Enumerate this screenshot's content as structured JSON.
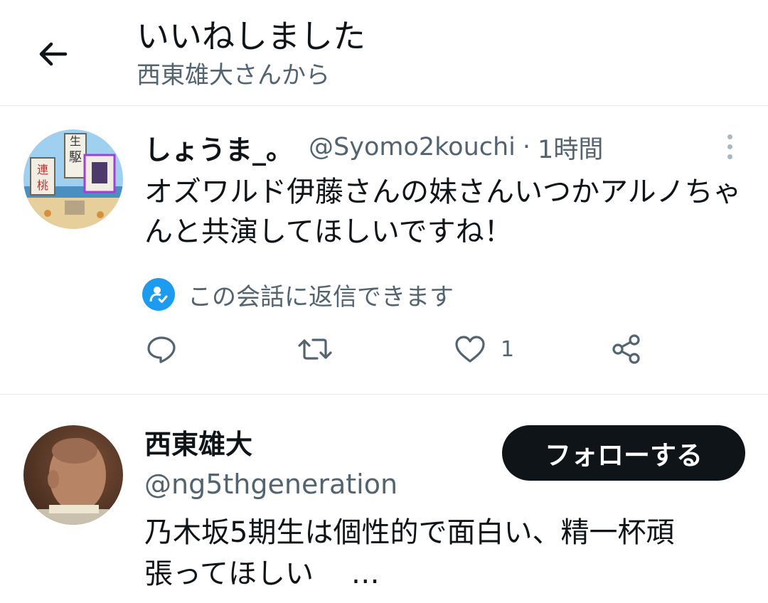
{
  "header": {
    "title": "いいねしました",
    "subtitle": "西東雄大さんから"
  },
  "tweet": {
    "name": "しょうま_。",
    "handle": "@Syomo2kouchi",
    "separator": "·",
    "time": "1時間",
    "text": "オズワルド伊藤さんの妹さんいつかアルノちゃんと共演してほしいですね！",
    "reply_note": "この会話に返信できます",
    "like_count": "1"
  },
  "user": {
    "name": "西東雄大",
    "handle": "@ng5thgeneration",
    "follow_label": "フォローする",
    "bio_line1": "乃木坂5期生は個性的で面白い、精一杯頑",
    "bio_line2": "張ってほしい　 …"
  },
  "colors": {
    "text": "#0f1419",
    "secondary": "#536471",
    "accent": "#1d9bf0",
    "follow_bg": "#0f1419",
    "divider": "#e6e9ec"
  },
  "icons": [
    "back-arrow-icon",
    "more-vertical-icon",
    "reply-permission-icon",
    "reply-icon",
    "retweet-icon",
    "like-icon",
    "share-icon"
  ]
}
